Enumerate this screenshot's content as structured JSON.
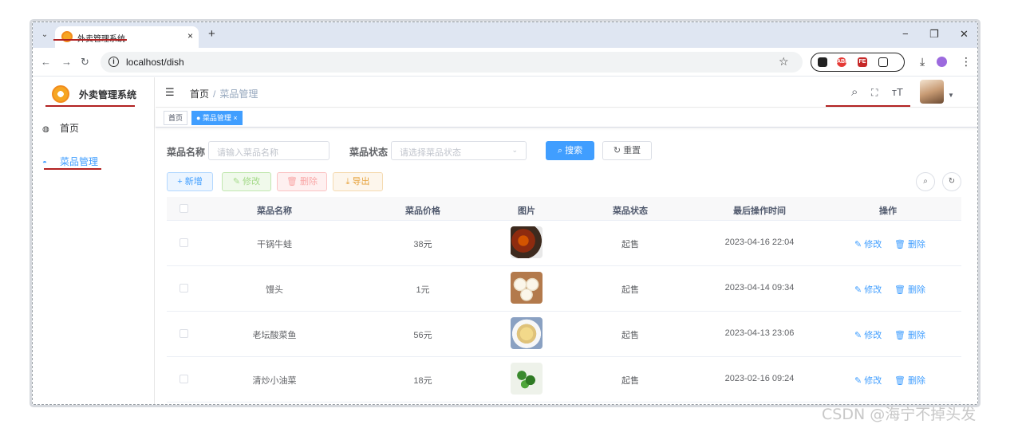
{
  "browser": {
    "tab_title": "外卖管理系统",
    "tab_close": "×",
    "new_tab": "+",
    "url": "localhost/dish",
    "extensions": [
      "ABP",
      "FE"
    ]
  },
  "app": {
    "title": "外卖管理系统"
  },
  "sidebar": {
    "items": [
      {
        "label": "首页",
        "icon": "dashboard-icon"
      },
      {
        "label": "菜品管理",
        "icon": "dish-icon",
        "active": true
      }
    ]
  },
  "breadcrumb": {
    "home": "首页",
    "sep": "/",
    "current": "菜品管理"
  },
  "tags": {
    "home": "首页",
    "active": "● 菜品管理 ×"
  },
  "search": {
    "name_label": "菜品名称",
    "name_placeholder": "请输入菜品名称",
    "status_label": "菜品状态",
    "status_placeholder": "请选择菜品状态",
    "search_button": "搜索",
    "reset_button": "重置"
  },
  "toolbar": {
    "add": "新增",
    "edit": "修改",
    "delete": "删除",
    "export": "导出"
  },
  "table": {
    "headers": [
      "菜品名称",
      "菜品价格",
      "图片",
      "菜品状态",
      "最后操作时间",
      "操作"
    ],
    "rows": [
      {
        "name": "干锅牛蛙",
        "price": "38元",
        "status": "起售",
        "time": "2023-04-16 22:04",
        "edit": "修改",
        "delete": "删除"
      },
      {
        "name": "馒头",
        "price": "1元",
        "status": "起售",
        "time": "2023-04-14 09:34",
        "edit": "修改",
        "delete": "删除"
      },
      {
        "name": "老坛酸菜鱼",
        "price": "56元",
        "status": "起售",
        "time": "2023-04-13 23:06",
        "edit": "修改",
        "delete": "删除"
      },
      {
        "name": "清炒小油菜",
        "price": "18元",
        "status": "起售",
        "time": "2023-02-16 09:24",
        "edit": "修改",
        "delete": "删除"
      }
    ]
  },
  "watermark": "CSDN @海宁不掉头发",
  "colors": {
    "primary": "#409eff",
    "annotation": "#b22222",
    "tabbar": "#dfe6f2"
  }
}
